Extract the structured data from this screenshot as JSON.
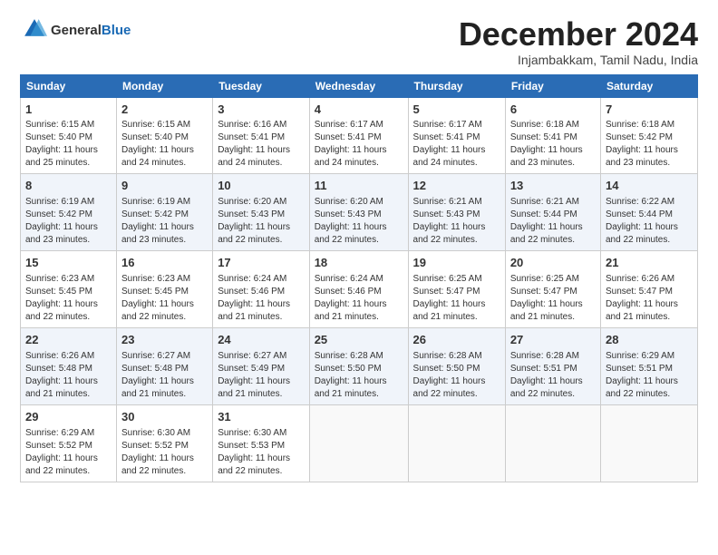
{
  "logo": {
    "text_general": "General",
    "text_blue": "Blue"
  },
  "title": "December 2024",
  "subtitle": "Injambakkam, Tamil Nadu, India",
  "weekdays": [
    "Sunday",
    "Monday",
    "Tuesday",
    "Wednesday",
    "Thursday",
    "Friday",
    "Saturday"
  ],
  "weeks": [
    [
      {
        "day": "1",
        "info": "Sunrise: 6:15 AM\nSunset: 5:40 PM\nDaylight: 11 hours\nand 25 minutes."
      },
      {
        "day": "2",
        "info": "Sunrise: 6:15 AM\nSunset: 5:40 PM\nDaylight: 11 hours\nand 24 minutes."
      },
      {
        "day": "3",
        "info": "Sunrise: 6:16 AM\nSunset: 5:41 PM\nDaylight: 11 hours\nand 24 minutes."
      },
      {
        "day": "4",
        "info": "Sunrise: 6:17 AM\nSunset: 5:41 PM\nDaylight: 11 hours\nand 24 minutes."
      },
      {
        "day": "5",
        "info": "Sunrise: 6:17 AM\nSunset: 5:41 PM\nDaylight: 11 hours\nand 24 minutes."
      },
      {
        "day": "6",
        "info": "Sunrise: 6:18 AM\nSunset: 5:41 PM\nDaylight: 11 hours\nand 23 minutes."
      },
      {
        "day": "7",
        "info": "Sunrise: 6:18 AM\nSunset: 5:42 PM\nDaylight: 11 hours\nand 23 minutes."
      }
    ],
    [
      {
        "day": "8",
        "info": "Sunrise: 6:19 AM\nSunset: 5:42 PM\nDaylight: 11 hours\nand 23 minutes."
      },
      {
        "day": "9",
        "info": "Sunrise: 6:19 AM\nSunset: 5:42 PM\nDaylight: 11 hours\nand 23 minutes."
      },
      {
        "day": "10",
        "info": "Sunrise: 6:20 AM\nSunset: 5:43 PM\nDaylight: 11 hours\nand 22 minutes."
      },
      {
        "day": "11",
        "info": "Sunrise: 6:20 AM\nSunset: 5:43 PM\nDaylight: 11 hours\nand 22 minutes."
      },
      {
        "day": "12",
        "info": "Sunrise: 6:21 AM\nSunset: 5:43 PM\nDaylight: 11 hours\nand 22 minutes."
      },
      {
        "day": "13",
        "info": "Sunrise: 6:21 AM\nSunset: 5:44 PM\nDaylight: 11 hours\nand 22 minutes."
      },
      {
        "day": "14",
        "info": "Sunrise: 6:22 AM\nSunset: 5:44 PM\nDaylight: 11 hours\nand 22 minutes."
      }
    ],
    [
      {
        "day": "15",
        "info": "Sunrise: 6:23 AM\nSunset: 5:45 PM\nDaylight: 11 hours\nand 22 minutes."
      },
      {
        "day": "16",
        "info": "Sunrise: 6:23 AM\nSunset: 5:45 PM\nDaylight: 11 hours\nand 22 minutes."
      },
      {
        "day": "17",
        "info": "Sunrise: 6:24 AM\nSunset: 5:46 PM\nDaylight: 11 hours\nand 21 minutes."
      },
      {
        "day": "18",
        "info": "Sunrise: 6:24 AM\nSunset: 5:46 PM\nDaylight: 11 hours\nand 21 minutes."
      },
      {
        "day": "19",
        "info": "Sunrise: 6:25 AM\nSunset: 5:47 PM\nDaylight: 11 hours\nand 21 minutes."
      },
      {
        "day": "20",
        "info": "Sunrise: 6:25 AM\nSunset: 5:47 PM\nDaylight: 11 hours\nand 21 minutes."
      },
      {
        "day": "21",
        "info": "Sunrise: 6:26 AM\nSunset: 5:47 PM\nDaylight: 11 hours\nand 21 minutes."
      }
    ],
    [
      {
        "day": "22",
        "info": "Sunrise: 6:26 AM\nSunset: 5:48 PM\nDaylight: 11 hours\nand 21 minutes."
      },
      {
        "day": "23",
        "info": "Sunrise: 6:27 AM\nSunset: 5:48 PM\nDaylight: 11 hours\nand 21 minutes."
      },
      {
        "day": "24",
        "info": "Sunrise: 6:27 AM\nSunset: 5:49 PM\nDaylight: 11 hours\nand 21 minutes."
      },
      {
        "day": "25",
        "info": "Sunrise: 6:28 AM\nSunset: 5:50 PM\nDaylight: 11 hours\nand 21 minutes."
      },
      {
        "day": "26",
        "info": "Sunrise: 6:28 AM\nSunset: 5:50 PM\nDaylight: 11 hours\nand 22 minutes."
      },
      {
        "day": "27",
        "info": "Sunrise: 6:28 AM\nSunset: 5:51 PM\nDaylight: 11 hours\nand 22 minutes."
      },
      {
        "day": "28",
        "info": "Sunrise: 6:29 AM\nSunset: 5:51 PM\nDaylight: 11 hours\nand 22 minutes."
      }
    ],
    [
      {
        "day": "29",
        "info": "Sunrise: 6:29 AM\nSunset: 5:52 PM\nDaylight: 11 hours\nand 22 minutes."
      },
      {
        "day": "30",
        "info": "Sunrise: 6:30 AM\nSunset: 5:52 PM\nDaylight: 11 hours\nand 22 minutes."
      },
      {
        "day": "31",
        "info": "Sunrise: 6:30 AM\nSunset: 5:53 PM\nDaylight: 11 hours\nand 22 minutes."
      },
      null,
      null,
      null,
      null
    ]
  ]
}
